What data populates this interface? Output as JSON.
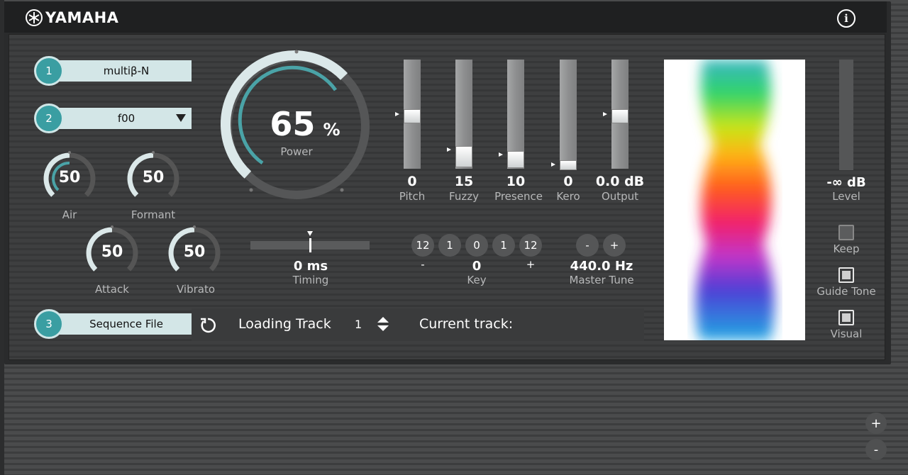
{
  "header": {
    "brand": "YAMAHA",
    "info_icon": "info-icon"
  },
  "slots": [
    {
      "number": "1",
      "value": "multiβ-N"
    },
    {
      "number": "2",
      "value": "f00"
    },
    {
      "number": "3",
      "value": "Sequence File"
    }
  ],
  "knobs": [
    {
      "label": "Air",
      "value": "50",
      "level": 50
    },
    {
      "label": "Formant",
      "value": "50",
      "level": 50
    },
    {
      "label": "Attack",
      "value": "50",
      "level": 50
    },
    {
      "label": "Vibrato",
      "value": "50",
      "level": 50
    }
  ],
  "power": {
    "value": "65",
    "unit": "%",
    "label": "Power",
    "level": 65
  },
  "faders": [
    {
      "label": "Pitch",
      "value": "0",
      "level": 0.5
    },
    {
      "label": "Fuzzy",
      "value": "15",
      "level": 0.15
    },
    {
      "label": "Presence",
      "value": "10",
      "level": 0.1
    },
    {
      "label": "Kero",
      "value": "0",
      "level": 0.0
    },
    {
      "label": "Output",
      "value": "0.0 dB",
      "level": 0.5
    }
  ],
  "timing": {
    "value": "0 ms",
    "label": "Timing"
  },
  "key": {
    "buttons": [
      "12",
      "1",
      "0",
      "1",
      "12"
    ],
    "minus": "-",
    "plus": "+",
    "value": "0",
    "label": "Key"
  },
  "master_tune": {
    "minus": "-",
    "plus": "+",
    "value": "440.0 Hz",
    "label": "Master Tune"
  },
  "level_meter": {
    "value": "-∞ dB",
    "label": "Level"
  },
  "toggles": [
    {
      "label": "Keep",
      "checked": false
    },
    {
      "label": "Guide Tone",
      "checked": true
    },
    {
      "label": "Visual",
      "checked": true
    }
  ],
  "sequence": {
    "loading_track_label": "Loading Track",
    "loading_track_value": "1",
    "current_track_label": "Current track:"
  },
  "zoom": {
    "plus": "+",
    "minus": "-"
  }
}
